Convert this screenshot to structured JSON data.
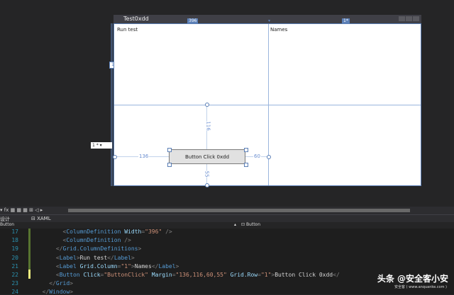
{
  "designer": {
    "window_title": "Test0xdd",
    "col_width_badge": "396",
    "col_star_badge": "1*",
    "row_badge": "1",
    "label_run_test": "Run test",
    "label_names": "Names",
    "button_text": "Button Click 0xdd",
    "margin_left": "136",
    "margin_top": "116",
    "margin_right": "60",
    "margin_bottom": "55",
    "row_height_value": "1",
    "row_height_unit": "*"
  },
  "toolbar": {
    "tools": "▾ fx ▦ ▦ ▦ ⊞ ◁ ▸"
  },
  "tabs": {
    "design": "设计",
    "xaml": "XAML",
    "element_left": "Button",
    "element_right": "Button"
  },
  "editor": {
    "lines": [
      {
        "num": "17",
        "code": [
          [
            "t-punct",
            "        <"
          ],
          [
            "t-tag",
            "ColumnDefinition "
          ],
          [
            "t-attr",
            "Width"
          ],
          [
            "t-punct",
            "="
          ],
          [
            "t-str",
            "\"396\""
          ],
          [
            "t-punct",
            " />"
          ]
        ]
      },
      {
        "num": "18",
        "code": [
          [
            "t-punct",
            "        <"
          ],
          [
            "t-tag",
            "ColumnDefinition"
          ],
          [
            "t-punct",
            " />"
          ]
        ]
      },
      {
        "num": "19",
        "code": [
          [
            "t-punct",
            "      </"
          ],
          [
            "t-tag",
            "Grid.ColumnDefinitions"
          ],
          [
            "t-punct",
            ">"
          ]
        ]
      },
      {
        "num": "20",
        "code": [
          [
            "t-punct",
            "      <"
          ],
          [
            "t-tag",
            "Label"
          ],
          [
            "t-punct",
            ">"
          ],
          [
            "t-text",
            "Run test"
          ],
          [
            "t-punct",
            "</"
          ],
          [
            "t-tag",
            "Label"
          ],
          [
            "t-punct",
            ">"
          ]
        ]
      },
      {
        "num": "21",
        "code": [
          [
            "t-punct",
            "      <"
          ],
          [
            "t-tag",
            "Label "
          ],
          [
            "t-attr",
            "Grid.Column"
          ],
          [
            "t-punct",
            "="
          ],
          [
            "t-str",
            "\"1\""
          ],
          [
            "t-punct",
            ">"
          ],
          [
            "t-text",
            "Names"
          ],
          [
            "t-punct",
            "</"
          ],
          [
            "t-tag",
            "Label"
          ],
          [
            "t-punct",
            ">"
          ]
        ]
      },
      {
        "num": "22",
        "code": [
          [
            "t-punct",
            "      <"
          ],
          [
            "t-tag",
            "Button "
          ],
          [
            "t-attr",
            "Click"
          ],
          [
            "t-punct",
            "="
          ],
          [
            "t-str",
            "\"ButtonClick\" "
          ],
          [
            "t-attr",
            "Margin"
          ],
          [
            "t-punct",
            "="
          ],
          [
            "t-str",
            "\"136,116,60,55\" "
          ],
          [
            "t-attr",
            "Grid.Row"
          ],
          [
            "t-punct",
            "="
          ],
          [
            "t-str",
            "\"1\""
          ],
          [
            "t-punct",
            ">"
          ],
          [
            "t-text",
            "Button Click 0xdd"
          ],
          [
            "t-punct",
            "</"
          ]
        ]
      },
      {
        "num": "23",
        "code": [
          [
            "t-punct",
            "    </"
          ],
          [
            "t-tag",
            "Grid"
          ],
          [
            "t-punct",
            ">"
          ]
        ]
      },
      {
        "num": "24",
        "code": [
          [
            "t-punct",
            "  </"
          ],
          [
            "t-tag",
            "Window"
          ],
          [
            "t-punct",
            ">"
          ]
        ]
      }
    ]
  },
  "watermark": {
    "main": "头条 @安全客小安",
    "sub": "安全客 ( www.anquanke.com )"
  },
  "colors": {
    "accent": "#5b7fb6",
    "editor_bg": "#1e1e1e",
    "panel_bg": "#252526"
  }
}
